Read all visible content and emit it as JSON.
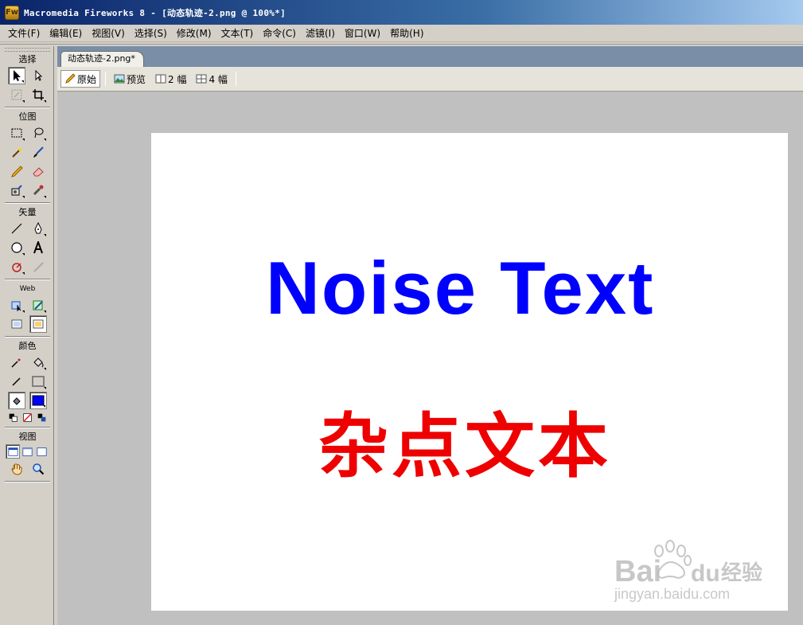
{
  "window": {
    "title": "Macromedia Fireworks 8 - [动态轨迹-2.png @ 100%*]",
    "logo_text": "Fw"
  },
  "menu": [
    {
      "label": "文件(F)"
    },
    {
      "label": "编辑(E)"
    },
    {
      "label": "视图(V)"
    },
    {
      "label": "选择(S)"
    },
    {
      "label": "修改(M)"
    },
    {
      "label": "文本(T)"
    },
    {
      "label": "命令(C)"
    },
    {
      "label": "滤镜(I)"
    },
    {
      "label": "窗口(W)"
    },
    {
      "label": "帮助(H)"
    }
  ],
  "tools": {
    "sections": {
      "select": "选择",
      "bitmap": "位图",
      "vector": "矢量",
      "web": "Web",
      "colors": "颜色",
      "view": "视图"
    },
    "stroke_color": "#808080",
    "fill_color": "#0000ff"
  },
  "document": {
    "tab_label": "动态轨迹-2.png*",
    "view_tabs": [
      {
        "label": "原始",
        "active": true
      },
      {
        "label": "预览",
        "active": false
      },
      {
        "label": "2 幅",
        "active": false
      },
      {
        "label": "4 幅",
        "active": false
      }
    ],
    "canvas": {
      "text_english": "Noise Text",
      "text_english_color": "#0000ff",
      "text_chinese": "杂点文本",
      "text_chinese_color": "#ee0000"
    }
  },
  "watermark": {
    "brand": "Bai du 经验",
    "url": "jingyan.baidu.com"
  }
}
